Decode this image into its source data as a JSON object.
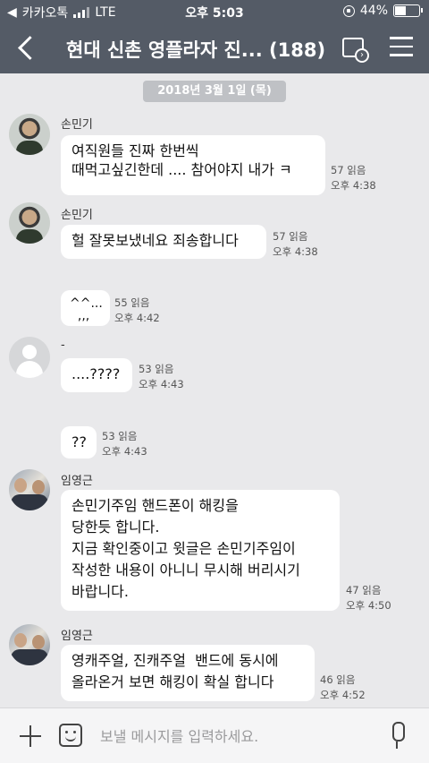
{
  "status": {
    "carrier": "카카오톡",
    "network": "LTE",
    "time": "오후 5:03",
    "battery": "44%",
    "battery_level": 0.44
  },
  "header": {
    "title": "현대 신촌 영플라자 진... (188)"
  },
  "date_divider": "2018년 3월 1일 (목)",
  "messages": [
    {
      "sender": "손민기",
      "text": "여직원들 진짜 한번씩\n때먹고싶긴한데 .... 참어야지 내가 ㅋ",
      "read": "57 읽음",
      "time": "오후 4:38"
    },
    {
      "sender": "손민기",
      "text": "헐 잘못보냈네요 죄송합니다",
      "read": "57 읽음",
      "time": "오후 4:38"
    },
    {
      "sender": "",
      "text": "^^...\n  ,,,",
      "read": "55 읽음",
      "time": "오후 4:42"
    },
    {
      "sender": "-",
      "text": "....????",
      "read": "53 읽음",
      "time": "오후 4:43"
    },
    {
      "sender": "",
      "text": "??",
      "read": "53 읽음",
      "time": "오후 4:43"
    },
    {
      "sender": "임영근",
      "text": "손민기주임 핸드폰이 해킹을\n당한듯 합니다.\n지금 확인중이고 윗글은 손민기주임이\n작성한 내용이 아니니 무시해 버리시기\n바랍니다.",
      "read": "47 읽음",
      "time": "오후 4:50"
    },
    {
      "sender": "임영근",
      "text": "영캐주얼, 진캐주얼  밴드에 동시에\n올라온거 보면 해킹이 확실 합니다",
      "read": "46 읽음",
      "time": "오후 4:52"
    }
  ],
  "input": {
    "placeholder": "보낼 메시지를 입력하세요."
  }
}
